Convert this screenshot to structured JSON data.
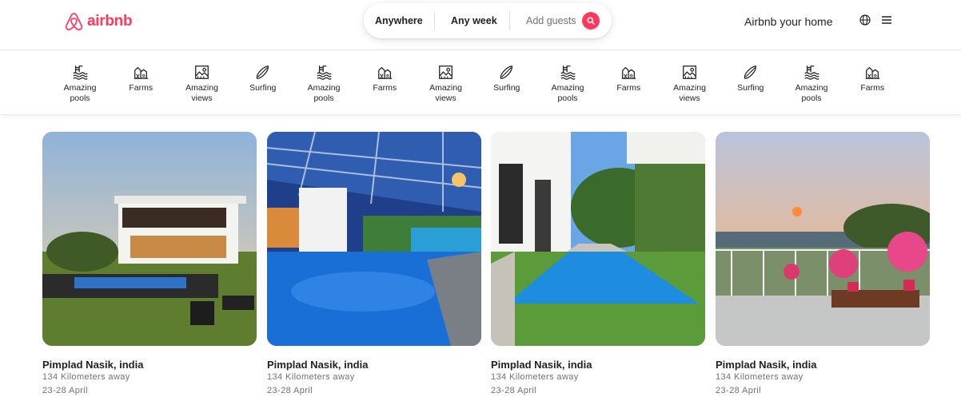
{
  "header": {
    "logo_text": "airbnb",
    "search": {
      "location": "Anywhere",
      "dates": "Any week",
      "guests_placeholder": "Add guests"
    },
    "host_link": "Airbnb your home",
    "icons": [
      "airbnb-logo-icon",
      "search-icon",
      "globe-icon",
      "menu-icon"
    ]
  },
  "categories": [
    {
      "label": "Amazing pools",
      "icon": "pool-icon"
    },
    {
      "label": "Farms",
      "icon": "farm-icon"
    },
    {
      "label": "Amazing views",
      "icon": "view-icon"
    },
    {
      "label": "Surfing",
      "icon": "surfboard-icon"
    },
    {
      "label": "Amazing pools",
      "icon": "pool-icon"
    },
    {
      "label": "Farms",
      "icon": "farm-icon"
    },
    {
      "label": "Amazing views",
      "icon": "view-icon"
    },
    {
      "label": "Surfing",
      "icon": "surfboard-icon"
    },
    {
      "label": "Amazing pools",
      "icon": "pool-icon"
    },
    {
      "label": "Farms",
      "icon": "farm-icon"
    },
    {
      "label": "Amazing views",
      "icon": "view-icon"
    },
    {
      "label": "Surfing",
      "icon": "surfboard-icon"
    },
    {
      "label": "Amazing pools",
      "icon": "pool-icon"
    },
    {
      "label": "Farms",
      "icon": "farm-icon"
    }
  ],
  "listings": [
    {
      "title": "Pimplad Nasik, india",
      "distance": "134 Kilometers away",
      "dates": "23-28 April"
    },
    {
      "title": "Pimplad Nasik, india",
      "distance": "134 Kilometers away",
      "dates": "23-28 April"
    },
    {
      "title": "Pimplad Nasik, india",
      "distance": "134 Kilometers away",
      "dates": "23-28 April"
    },
    {
      "title": "Pimplad Nasik, india",
      "distance": "134 Kilometers away",
      "dates": "23-28 April"
    }
  ],
  "colors": {
    "brand": "#ff385c",
    "text": "#222222",
    "muted": "#717171",
    "border": "#dddddd"
  }
}
